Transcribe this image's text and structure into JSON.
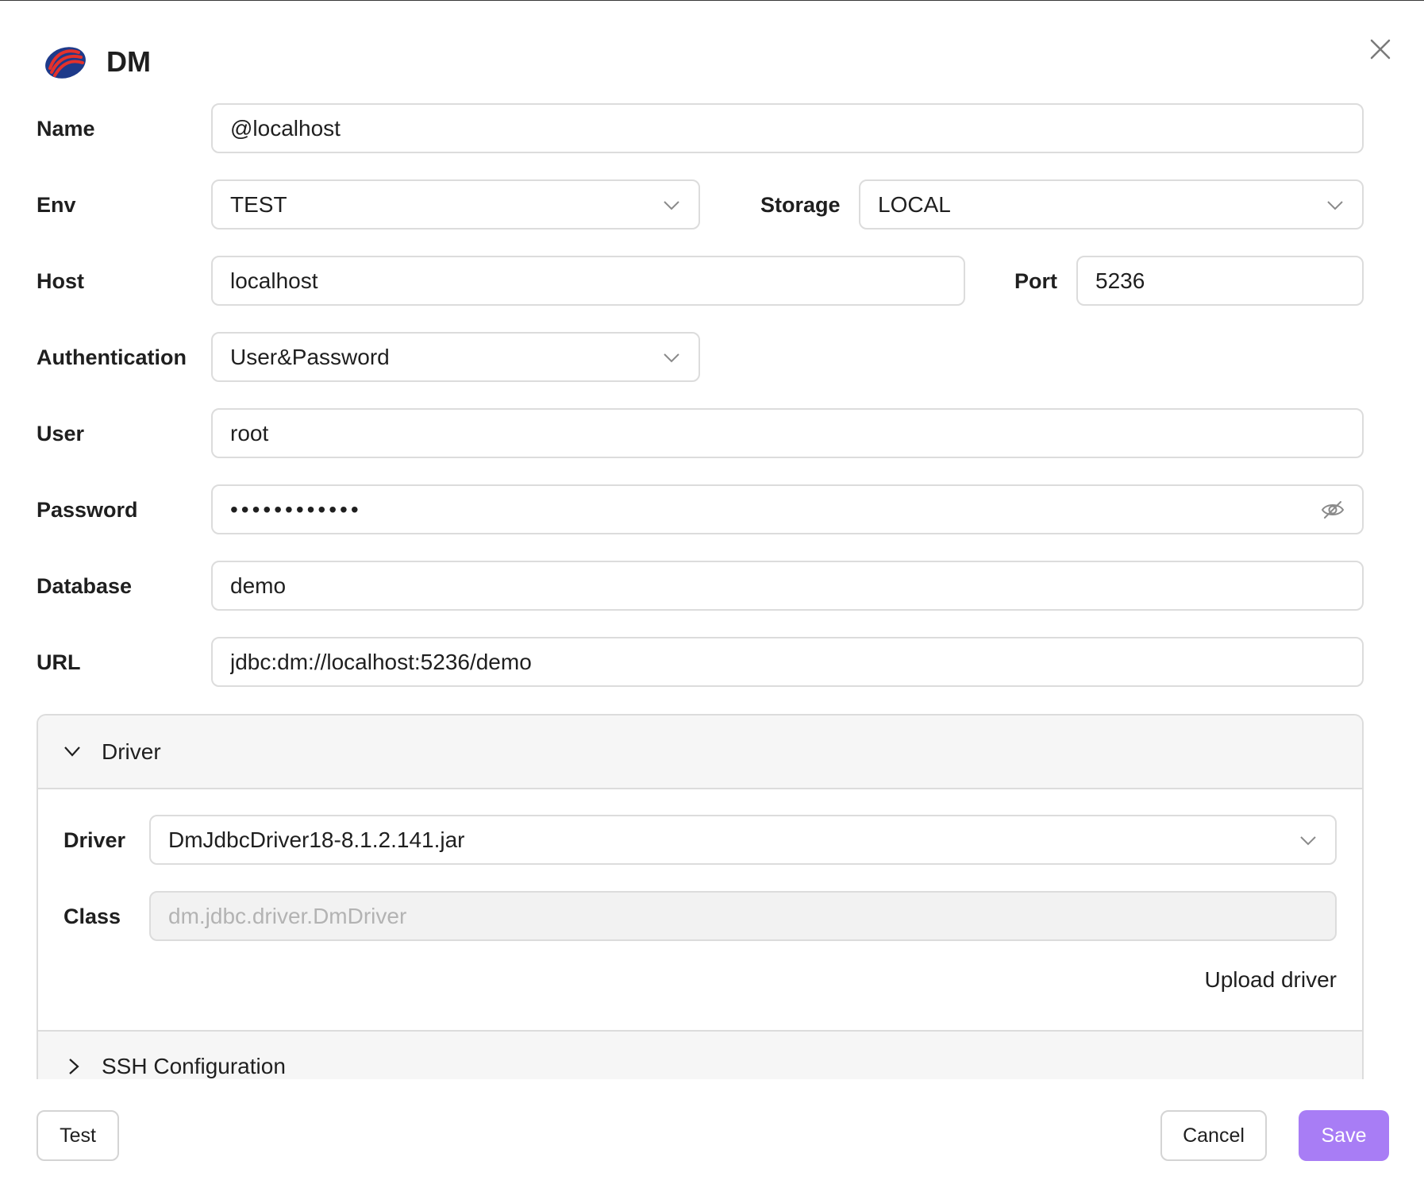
{
  "header": {
    "title": "DM",
    "logo_icon": "dm-logo-icon",
    "close_icon": "close-icon"
  },
  "form": {
    "name": {
      "label": "Name",
      "value": "@localhost"
    },
    "env": {
      "label": "Env",
      "value": "TEST"
    },
    "storage": {
      "label": "Storage",
      "value": "LOCAL"
    },
    "host": {
      "label": "Host",
      "value": "localhost"
    },
    "port": {
      "label": "Port",
      "value": "5236"
    },
    "authentication": {
      "label": "Authentication",
      "value": "User&Password"
    },
    "user": {
      "label": "User",
      "value": "root"
    },
    "password": {
      "label": "Password",
      "value": "••••••••••••"
    },
    "database": {
      "label": "Database",
      "value": "demo"
    },
    "url": {
      "label": "URL",
      "value": "jdbc:dm://localhost:5236/demo"
    }
  },
  "driver_panel": {
    "title": "Driver",
    "driver": {
      "label": "Driver",
      "value": "DmJdbcDriver18-8.1.2.141.jar"
    },
    "class": {
      "label": "Class",
      "placeholder": "dm.jdbc.driver.DmDriver"
    },
    "upload_label": "Upload driver"
  },
  "ssh_panel": {
    "title": "SSH Configuration"
  },
  "footer": {
    "test_label": "Test",
    "cancel_label": "Cancel",
    "save_label": "Save"
  },
  "colors": {
    "primary": "#a87df5",
    "border": "#dcdcdc",
    "panel_header_bg": "#f6f6f6",
    "disabled_bg": "#f2f2f2",
    "logo_red": "#e4312b",
    "logo_blue": "#1e3a8a"
  }
}
